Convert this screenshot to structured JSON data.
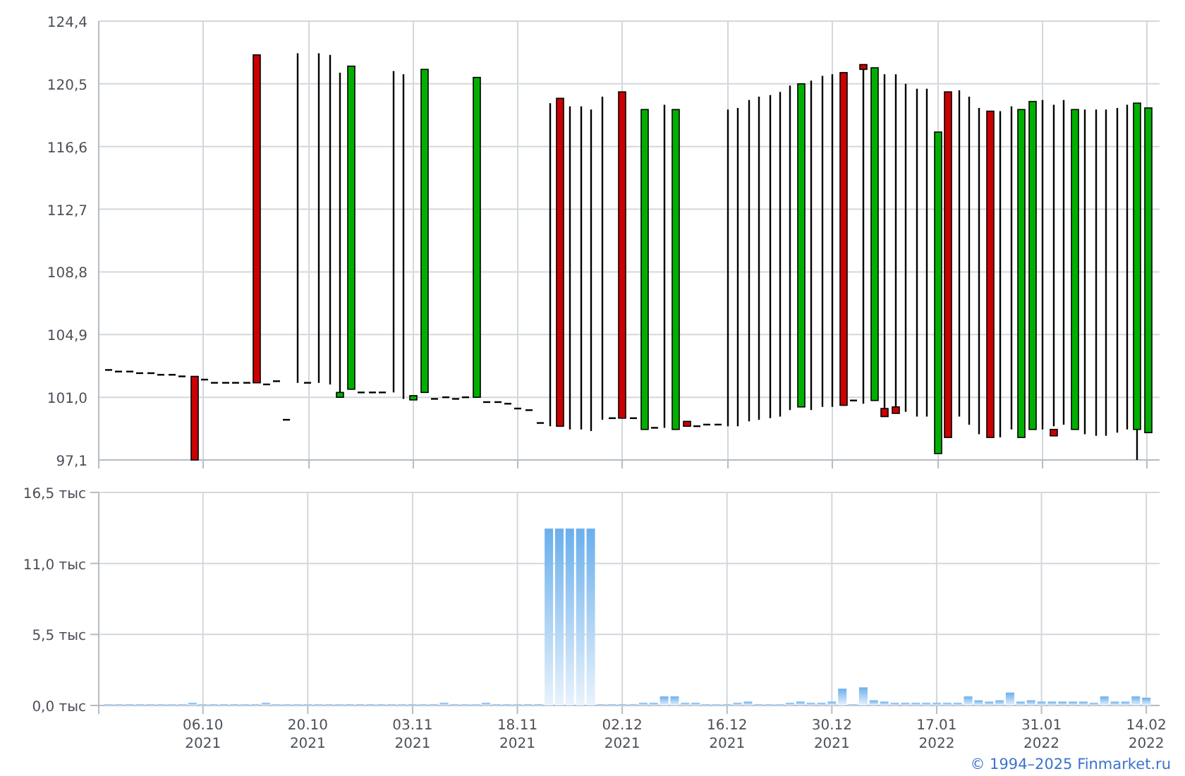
{
  "price_chart": {
    "y_labels": [
      "124,4",
      "120,5",
      "116,6",
      "112,7",
      "108,8",
      "104,9",
      "101,0",
      "97,1"
    ]
  },
  "volume_chart": {
    "chart_data": {
      "type": "bar",
      "grid": true,
      "ylim": [
        0,
        16.5
      ],
      "categories": [
        null,
        null,
        null,
        null,
        null,
        null,
        null,
        null,
        null,
        "06.10\n2021",
        null,
        null,
        null,
        null,
        null,
        null,
        null,
        null,
        null,
        "20.10\n2021",
        null,
        null,
        null,
        null,
        null,
        null,
        null,
        null,
        null,
        "03.11\n2021",
        null,
        null,
        null,
        null,
        null,
        null,
        null,
        null,
        null,
        "18.11\n2021",
        null,
        null,
        null,
        null,
        null,
        null,
        null,
        null,
        null,
        "02.12\n2021",
        null,
        null,
        null,
        null,
        null,
        null,
        null,
        null,
        null,
        "16.12\n2021",
        null,
        null,
        null,
        null,
        null,
        null,
        null,
        null,
        null,
        "30.12\n2021",
        null,
        null,
        null,
        null,
        null,
        null,
        null,
        null,
        null,
        "17.01\n2022",
        null,
        null,
        null,
        null,
        null,
        null,
        null,
        null,
        null,
        "31.01\n2022",
        null,
        null,
        null,
        null,
        null,
        null,
        null,
        null,
        null,
        "14.02\n2022"
      ],
      "yticks": [
        {
          "value": 0,
          "label": "0,0 тыс"
        },
        {
          "value": 5.5,
          "label": "5,5 тыс"
        },
        {
          "value": 11,
          "label": "11,0 тыс"
        },
        {
          "value": 16.5,
          "label": "16,5 тыс"
        }
      ],
      "values": [
        0.1,
        0.1,
        0.1,
        0.1,
        0.1,
        0.1,
        0.1,
        0.1,
        0.2,
        0.1,
        0.1,
        0.1,
        0.1,
        0.1,
        0.1,
        0.2,
        0.1,
        0.1,
        0.1,
        0.1,
        0.1,
        0.1,
        0.1,
        0.1,
        0.1,
        0.1,
        0.1,
        0.1,
        0.1,
        0.1,
        0.1,
        0.1,
        0.2,
        0.1,
        0.1,
        0.1,
        0.2,
        0.1,
        0.1,
        0.1,
        0.1,
        0.1,
        13.7,
        13.7,
        13.7,
        13.7,
        13.7,
        0.1,
        0.1,
        0.1,
        0.1,
        0.2,
        0.2,
        0.7,
        0.7,
        0.2,
        0.2,
        0.1,
        0.1,
        0.1,
        0.2,
        0.3,
        0.1,
        0.1,
        0.1,
        0.2,
        0.3,
        0.2,
        0.2,
        0.3,
        1.3,
        0.1,
        1.4,
        0.4,
        0.3,
        0.2,
        0.2,
        0.2,
        0.2,
        0.2,
        0.2,
        0.2,
        0.7,
        0.4,
        0.3,
        0.4,
        1.0,
        0.3,
        0.4,
        0.3,
        0.3,
        0.3,
        0.3,
        0.3,
        0.2,
        0.7,
        0.3,
        0.3,
        0.7,
        0.6
      ]
    }
  },
  "footer": {
    "copyright": "© 1994–2025 Finmarket.ru"
  }
}
